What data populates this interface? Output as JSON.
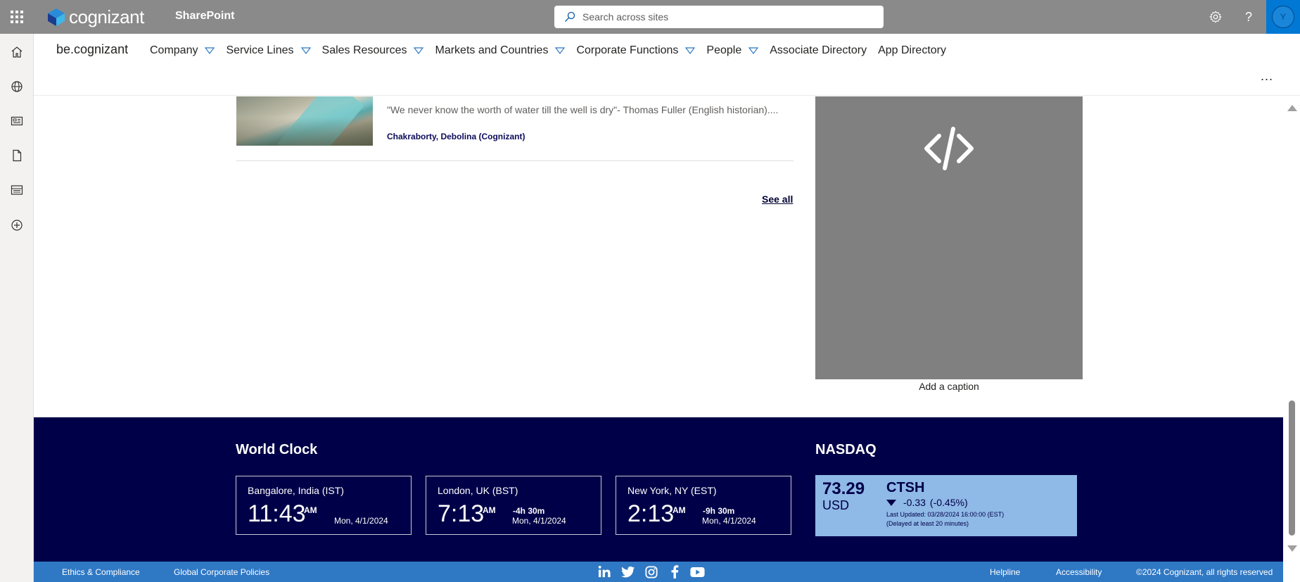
{
  "suite": {
    "logo_text": "cognizant",
    "app_name": "SharePoint",
    "search_placeholder": "Search across sites",
    "avatar_initial": "Y"
  },
  "site": {
    "title": "be.cognizant",
    "nav": [
      {
        "label": "Company",
        "dropdown": true
      },
      {
        "label": "Service Lines",
        "dropdown": true
      },
      {
        "label": "Sales Resources",
        "dropdown": true
      },
      {
        "label": "Markets and Countries",
        "dropdown": true
      },
      {
        "label": "Corporate Functions",
        "dropdown": true
      },
      {
        "label": "People",
        "dropdown": true
      },
      {
        "label": "Associate Directory",
        "dropdown": false
      },
      {
        "label": "App Directory",
        "dropdown": false
      }
    ],
    "more_label": "..."
  },
  "news": {
    "description": "\"We never know the worth of water till the well is dry\"- Thomas Fuller (English historian)....",
    "author": "Chakraborty, Debolina (Cognizant)",
    "see_all": "See all"
  },
  "embed": {
    "caption": "Add a caption",
    "icon": "code-embed-icon"
  },
  "world_clock": {
    "title": "World Clock",
    "clocks": [
      {
        "city": "Bangalore, India (IST)",
        "time": "11:43",
        "ampm": "AM",
        "offset": "",
        "date": "Mon, 4/1/2024"
      },
      {
        "city": "London, UK (BST)",
        "time": "7:13",
        "ampm": "AM",
        "offset": "-4h 30m",
        "date": "Mon, 4/1/2024"
      },
      {
        "city": "New York, NY (EST)",
        "time": "2:13",
        "ampm": "AM",
        "offset": "-9h 30m",
        "date": "Mon, 4/1/2024"
      }
    ]
  },
  "nasdaq": {
    "title": "NASDAQ",
    "price": "73.29",
    "currency": "USD",
    "symbol": "CTSH",
    "change": "-0.33",
    "change_pct": "(-0.45%)",
    "direction": "down",
    "last_updated": "Last Updated: 03/28/2024 16:00:00 (EST)",
    "delayed": "(Delayed at least 20 minutes)"
  },
  "footer": {
    "ethics": "Ethics & Compliance",
    "policies": "Global Corporate Policies",
    "helpline": "Helpline",
    "accessibility": "Accessibility",
    "copyright": "©2024 Cognizant, all rights reserved",
    "social": [
      "linkedin-icon",
      "twitter-icon",
      "instagram-icon",
      "facebook-icon",
      "youtube-icon"
    ]
  },
  "colors": {
    "suite_bar": "#8a8a8a",
    "footer_band": "#000048",
    "footer_bar": "#2f78c4",
    "stock_card": "#8fb9e6",
    "avatar_bg": "#0078d4"
  }
}
